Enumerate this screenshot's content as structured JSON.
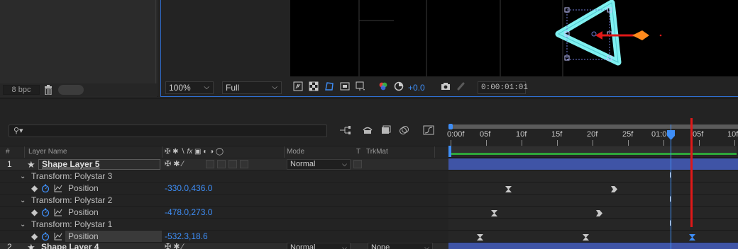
{
  "project": {
    "bpc_label": "8 bpc"
  },
  "viewer": {
    "magnification": "100%",
    "resolution": "Full",
    "exposure": "+0.0",
    "timecode": "0:00:01:01"
  },
  "timeline": {
    "search_placeholder": "",
    "columns": {
      "num": "#",
      "layer_name": "Layer Name",
      "mode": "Mode",
      "t": "T",
      "trkmat": "TrkMat"
    },
    "ruler": [
      "0:00f",
      "05f",
      "10f",
      "15f",
      "20f",
      "25f",
      "01:00f",
      "05f",
      "10f"
    ],
    "layers": [
      {
        "index": "1",
        "name": "Shape Layer 5",
        "mode": "Normal",
        "trkmat": "",
        "groups": [
          {
            "name": "Transform: Polystar 3",
            "property": "Position",
            "value": "-330.0,436.0"
          },
          {
            "name": "Transform: Polystar 2",
            "property": "Position",
            "value": "-478.0,273.0"
          },
          {
            "name": "Transform: Polystar 1",
            "property": "Position",
            "value": "-532.3,18.6"
          }
        ]
      },
      {
        "index": "2",
        "name": "Shape Layer 4",
        "mode": "Normal",
        "trkmat": "None"
      }
    ]
  },
  "colors": {
    "accent_blue": "#3e8ef7",
    "layer_bar": "#3f54a6",
    "shape_cyan": "#7ff0f0",
    "arrow_orange": "#ff8a1c",
    "guide_red": "#e01818"
  }
}
